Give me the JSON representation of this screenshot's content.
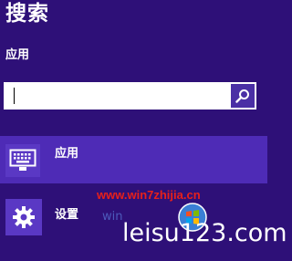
{
  "search_pane": {
    "title": "搜索",
    "scope_label": "应用",
    "search_input": {
      "value": "",
      "placeholder": ""
    },
    "search_button_icon": "magnifier-icon"
  },
  "results": [
    {
      "label": "应用",
      "icon": "keyboard-icon",
      "selected": true
    },
    {
      "label": "设置",
      "icon": "gear-icon",
      "selected": false
    }
  ],
  "watermark": {
    "site_url": "www.win7zhijia.cn",
    "site_name": "leisu123.com",
    "faint_text": "win"
  },
  "colors": {
    "background": "#2e1078",
    "selected_result": "#4e2bb6",
    "tile": "#5a38c4",
    "search_button": "#4a2fa5",
    "watermark_red": "#e8201a"
  }
}
